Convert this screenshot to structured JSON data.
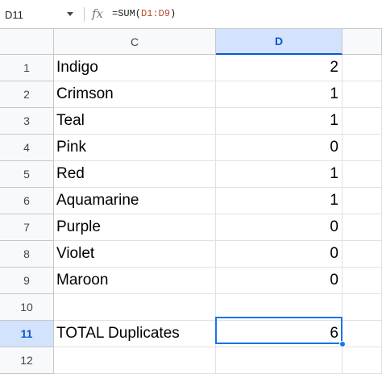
{
  "formula_bar": {
    "name_box": "D11",
    "fx_icon": "fx-icon",
    "formula_prefix": "=SUM(",
    "formula_range": "D1:D9",
    "formula_suffix": ")",
    "range_color": "#b7472a"
  },
  "columns": [
    "C",
    "D",
    ""
  ],
  "selected_column": "D",
  "rows": [
    {
      "num": "1",
      "c": "Indigo",
      "d": "2"
    },
    {
      "num": "2",
      "c": "Crimson",
      "d": "1"
    },
    {
      "num": "3",
      "c": "Teal",
      "d": "1"
    },
    {
      "num": "4",
      "c": "Pink",
      "d": "0"
    },
    {
      "num": "5",
      "c": "Red",
      "d": "1"
    },
    {
      "num": "6",
      "c": "Aquamarine",
      "d": "1"
    },
    {
      "num": "7",
      "c": "Purple",
      "d": "0"
    },
    {
      "num": "8",
      "c": "Violet",
      "d": "0"
    },
    {
      "num": "9",
      "c": "Maroon",
      "d": "0"
    },
    {
      "num": "10",
      "c": "",
      "d": ""
    },
    {
      "num": "11",
      "c": "TOTAL Duplicates",
      "d": "6"
    },
    {
      "num": "12",
      "c": "",
      "d": ""
    }
  ],
  "active_cell": "D11",
  "selection_color": "#1a73e8"
}
